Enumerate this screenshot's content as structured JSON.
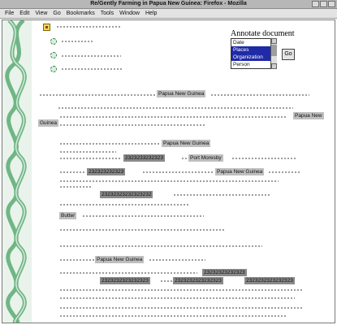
{
  "window": {
    "title": "Re/Gently Farming in Papua New Guinea: Firefox - Mozilla"
  },
  "menubar": {
    "items": [
      "File",
      "Edit",
      "View",
      "Go",
      "Bookmarks",
      "Tools",
      "Window",
      "Help"
    ]
  },
  "annotate": {
    "heading": "Annotate document",
    "options": [
      {
        "label": "Date",
        "selected": false
      },
      {
        "label": "Places",
        "selected": true
      },
      {
        "label": "Organization",
        "selected": true
      },
      {
        "label": "Person",
        "selected": false
      }
    ],
    "go_label": "Go"
  },
  "content": {
    "tag_png_1": "Papua New Guinea",
    "tag_png_2": "Papua New",
    "tag_guinea": "Guinea",
    "tag_png_3": "Papua New Guinea",
    "tag_numbers_1": "2323233232323",
    "tag_port": "Port Moresby",
    "tag_numbers_2": "232323232323",
    "tag_png_4": "Papua New Guinea",
    "tag_numbers_3": "23232323232323232",
    "tag_butter": "Butter",
    "tag_png_5": "Papua New Guinea",
    "tag_numbers_4": "23232323232323",
    "tag_numbers_5": "2323232323232323",
    "tag_numbers_6": "2323232323232323",
    "tag_numbers_7": "2323232323232323"
  },
  "colors": {
    "rail_pattern": "#7fbf8f",
    "selection": "#1f2aa6",
    "tag_highlight": "#bfbfbf"
  }
}
